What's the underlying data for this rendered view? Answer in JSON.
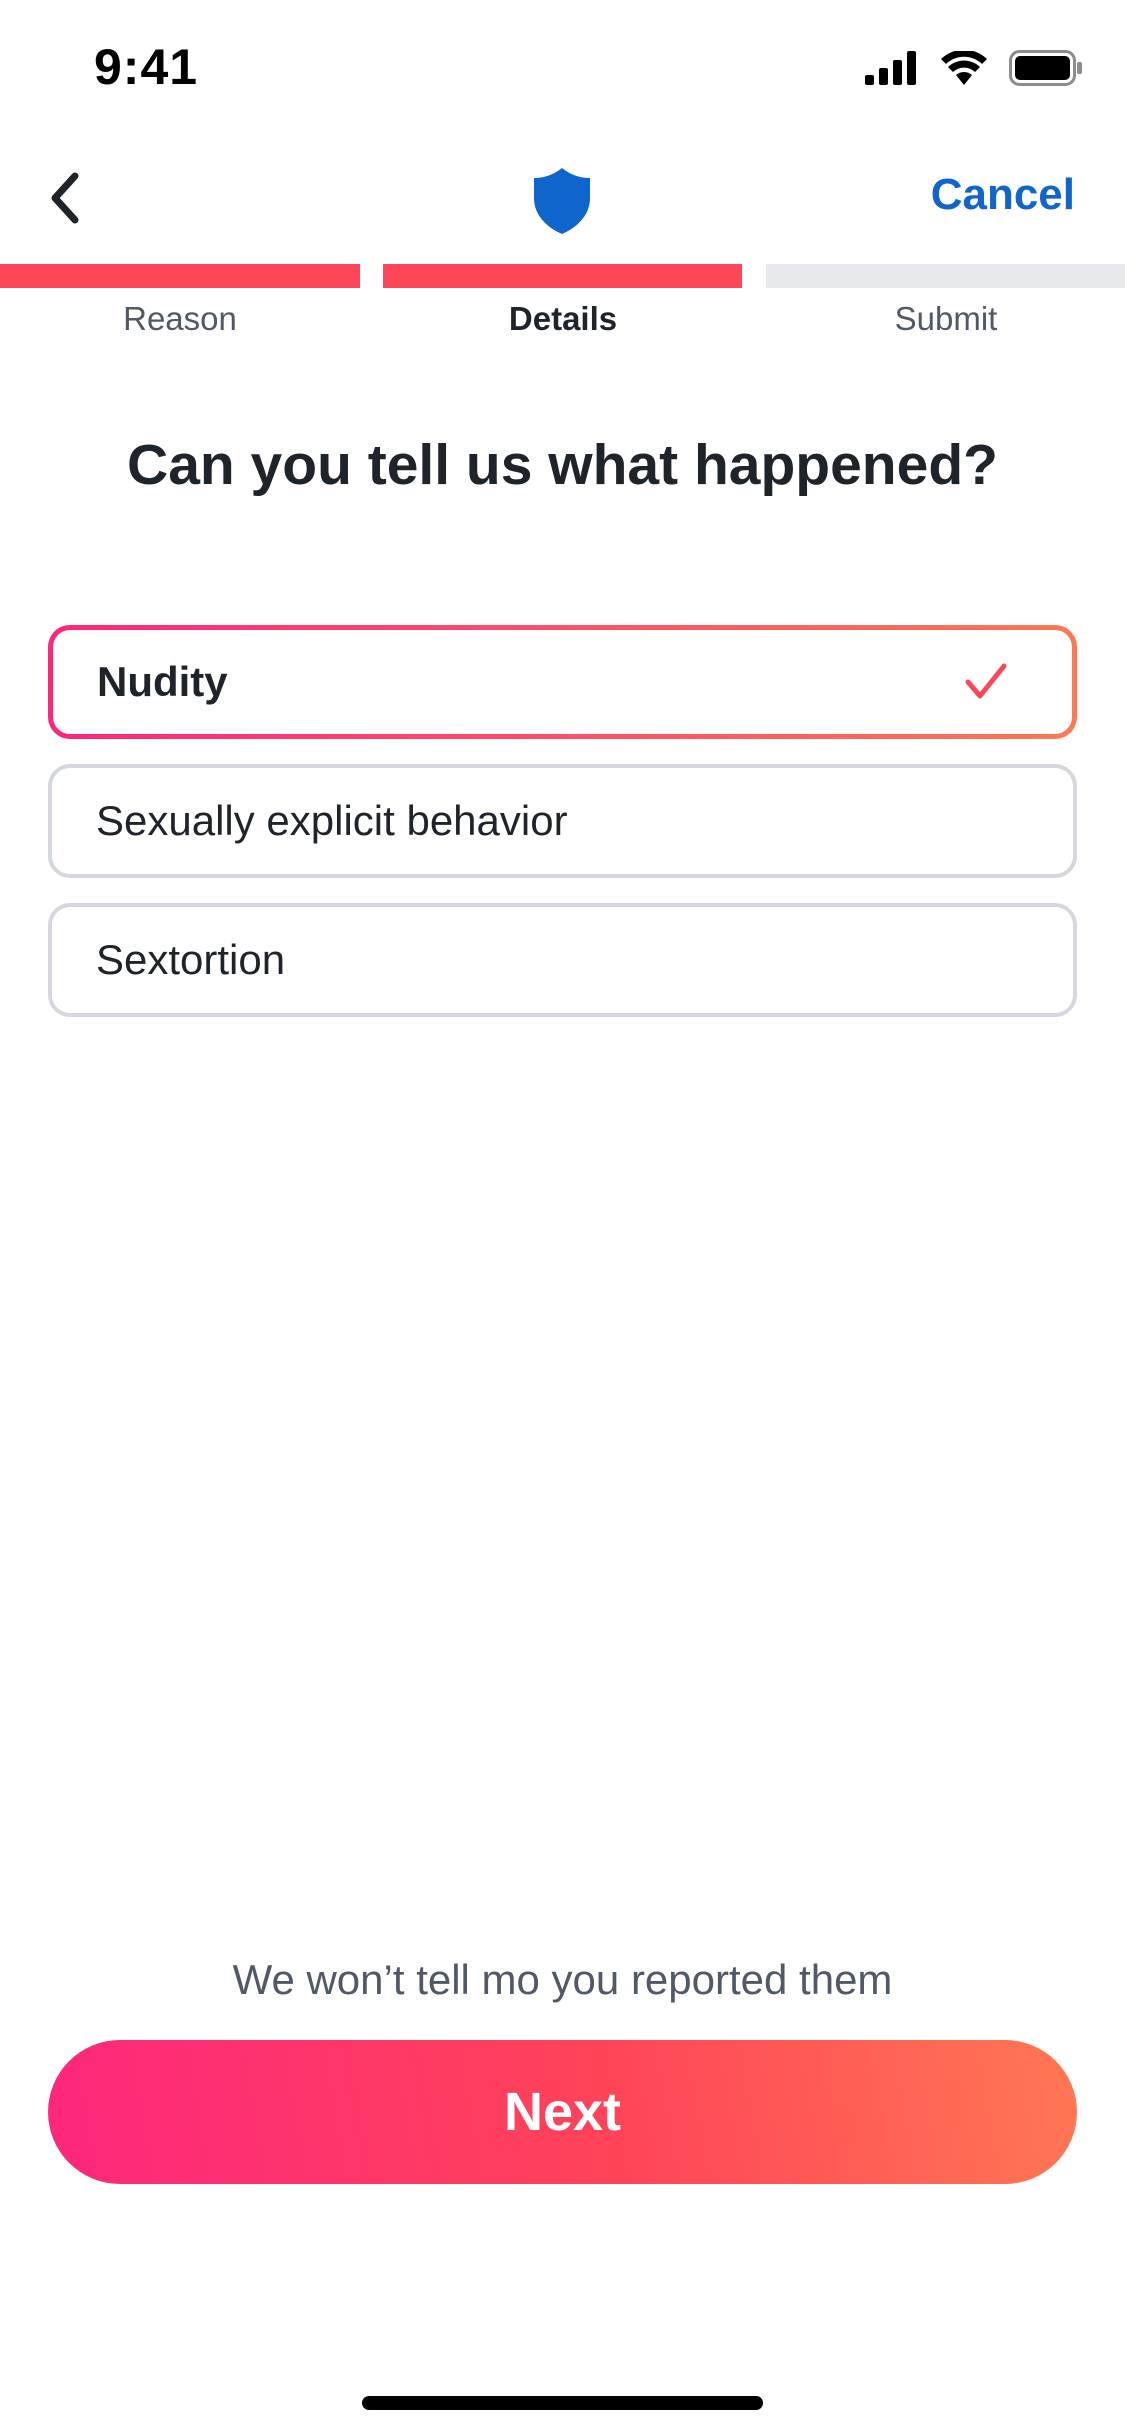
{
  "status_bar": {
    "time": "9:41",
    "icons": [
      "cellular-signal-icon",
      "wifi-icon",
      "battery-icon"
    ]
  },
  "nav": {
    "back_icon": "chevron-left-icon",
    "center_icon": "shield-icon",
    "cancel_label": "Cancel"
  },
  "progress": {
    "steps": [
      {
        "label": "Reason",
        "state": "complete"
      },
      {
        "label": "Details",
        "state": "current"
      },
      {
        "label": "Submit",
        "state": "upcoming"
      }
    ]
  },
  "question": {
    "title": "Can you tell us what happened?"
  },
  "options": [
    {
      "label": "Nudity",
      "selected": true
    },
    {
      "label": "Sexually explicit behavior",
      "selected": false
    },
    {
      "label": "Sextortion",
      "selected": false
    }
  ],
  "footer": {
    "privacy_note": "We won’t tell mo you reported them",
    "next_label": "Next"
  },
  "colors": {
    "brand_gradient_start": "#fd267d",
    "brand_gradient_end": "#ff7854",
    "progress_active": "#fd4657",
    "progress_inactive": "#e8e9ed",
    "link_blue": "#1065cc",
    "shield_blue": "#1065cc",
    "text_primary": "#1f242b",
    "text_secondary": "#505965",
    "option_border": "#d4d8de",
    "check": "#fd4657"
  }
}
